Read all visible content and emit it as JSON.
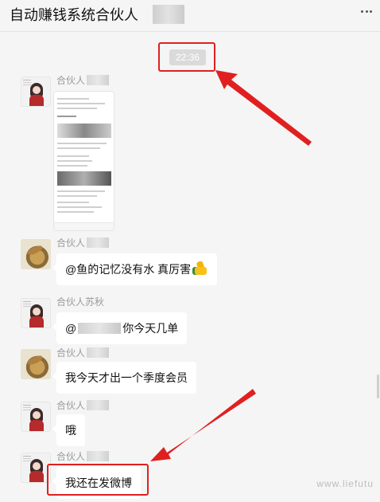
{
  "header": {
    "title": "自动赚钱系统合伙人"
  },
  "timestamp": "22:36",
  "messages": [
    {
      "sender": "合伙人",
      "type": "image"
    },
    {
      "sender": "合伙人",
      "text": "@鱼的记忆没有水 真厉害"
    },
    {
      "sender": "合伙人苏秋",
      "text_prefix": "@",
      "text_suffix": "你今天几单"
    },
    {
      "sender": "合伙人",
      "text": "我今天才出一个季度会员"
    },
    {
      "sender": "合伙人",
      "text": "哦"
    },
    {
      "sender": "合伙人",
      "text": "我还在发微博"
    }
  ],
  "watermark": "www.liefutu",
  "colors": {
    "highlight": "#e02020",
    "background": "#f5f5f5"
  }
}
